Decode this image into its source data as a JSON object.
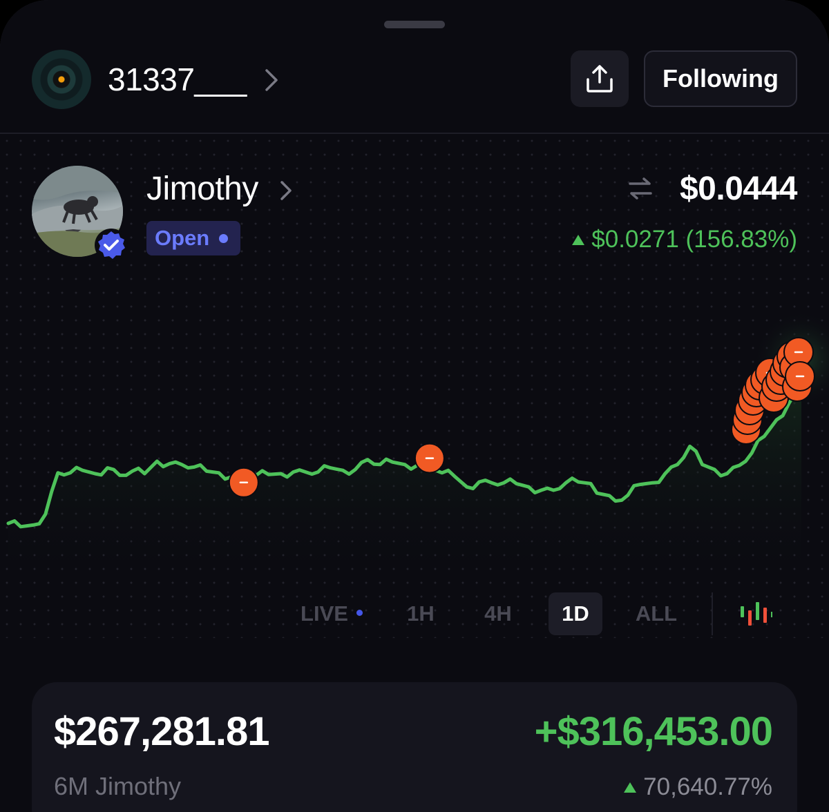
{
  "header": {
    "wallet_name": "31337___",
    "follow_label": "Following"
  },
  "token": {
    "name": "Jimothy",
    "status": "Open",
    "price": "$0.0444",
    "change": "$0.0271 (156.83%)",
    "change_direction": "up",
    "verified": true
  },
  "timeframes": [
    {
      "label": "LIVE",
      "active": false
    },
    {
      "label": "1H",
      "active": false
    },
    {
      "label": "4H",
      "active": false
    },
    {
      "label": "1D",
      "active": true
    },
    {
      "label": "ALL",
      "active": false
    }
  ],
  "chart_data": {
    "type": "line",
    "y_values": [
      0.0185,
      0.0181,
      0.0183,
      0.0196,
      0.0246,
      0.0246,
      0.0249,
      0.0245,
      0.0252,
      0.0243,
      0.0248,
      0.0245,
      0.026,
      0.0257,
      0.0256,
      0.0253,
      0.0248,
      0.0246,
      0.0241,
      0.0246,
      0.0243,
      0.0244,
      0.0245,
      0.0247,
      0.0247,
      0.0247,
      0.0252,
      0.0249,
      0.025,
      0.0262,
      0.0256,
      0.0259,
      0.0256,
      0.0255,
      0.0257,
      0.0246,
      0.0242,
      0.0229,
      0.0235,
      0.0234,
      0.0234,
      0.0233,
      0.0229,
      0.0225,
      0.0225,
      0.0234,
      0.0235,
      0.0233,
      0.022,
      0.0212,
      0.0219,
      0.0232,
      0.0234,
      0.0245,
      0.0256,
      0.0278,
      0.0256,
      0.025,
      0.0245,
      0.0255,
      0.027,
      0.029,
      0.031,
      0.033,
      0.035
    ],
    "sell_markers_count": 20,
    "line_color": "#4ec25a",
    "marker_color": "#f15a24"
  },
  "position": {
    "value": "$267,281.81",
    "label": "6M Jimothy",
    "pnl": "+$316,453.00",
    "pnl_pct": "70,640.77%"
  },
  "icons": {
    "share": "share-icon",
    "swap": "swap-arrows-icon",
    "chart_type": "candlestick-icon"
  }
}
